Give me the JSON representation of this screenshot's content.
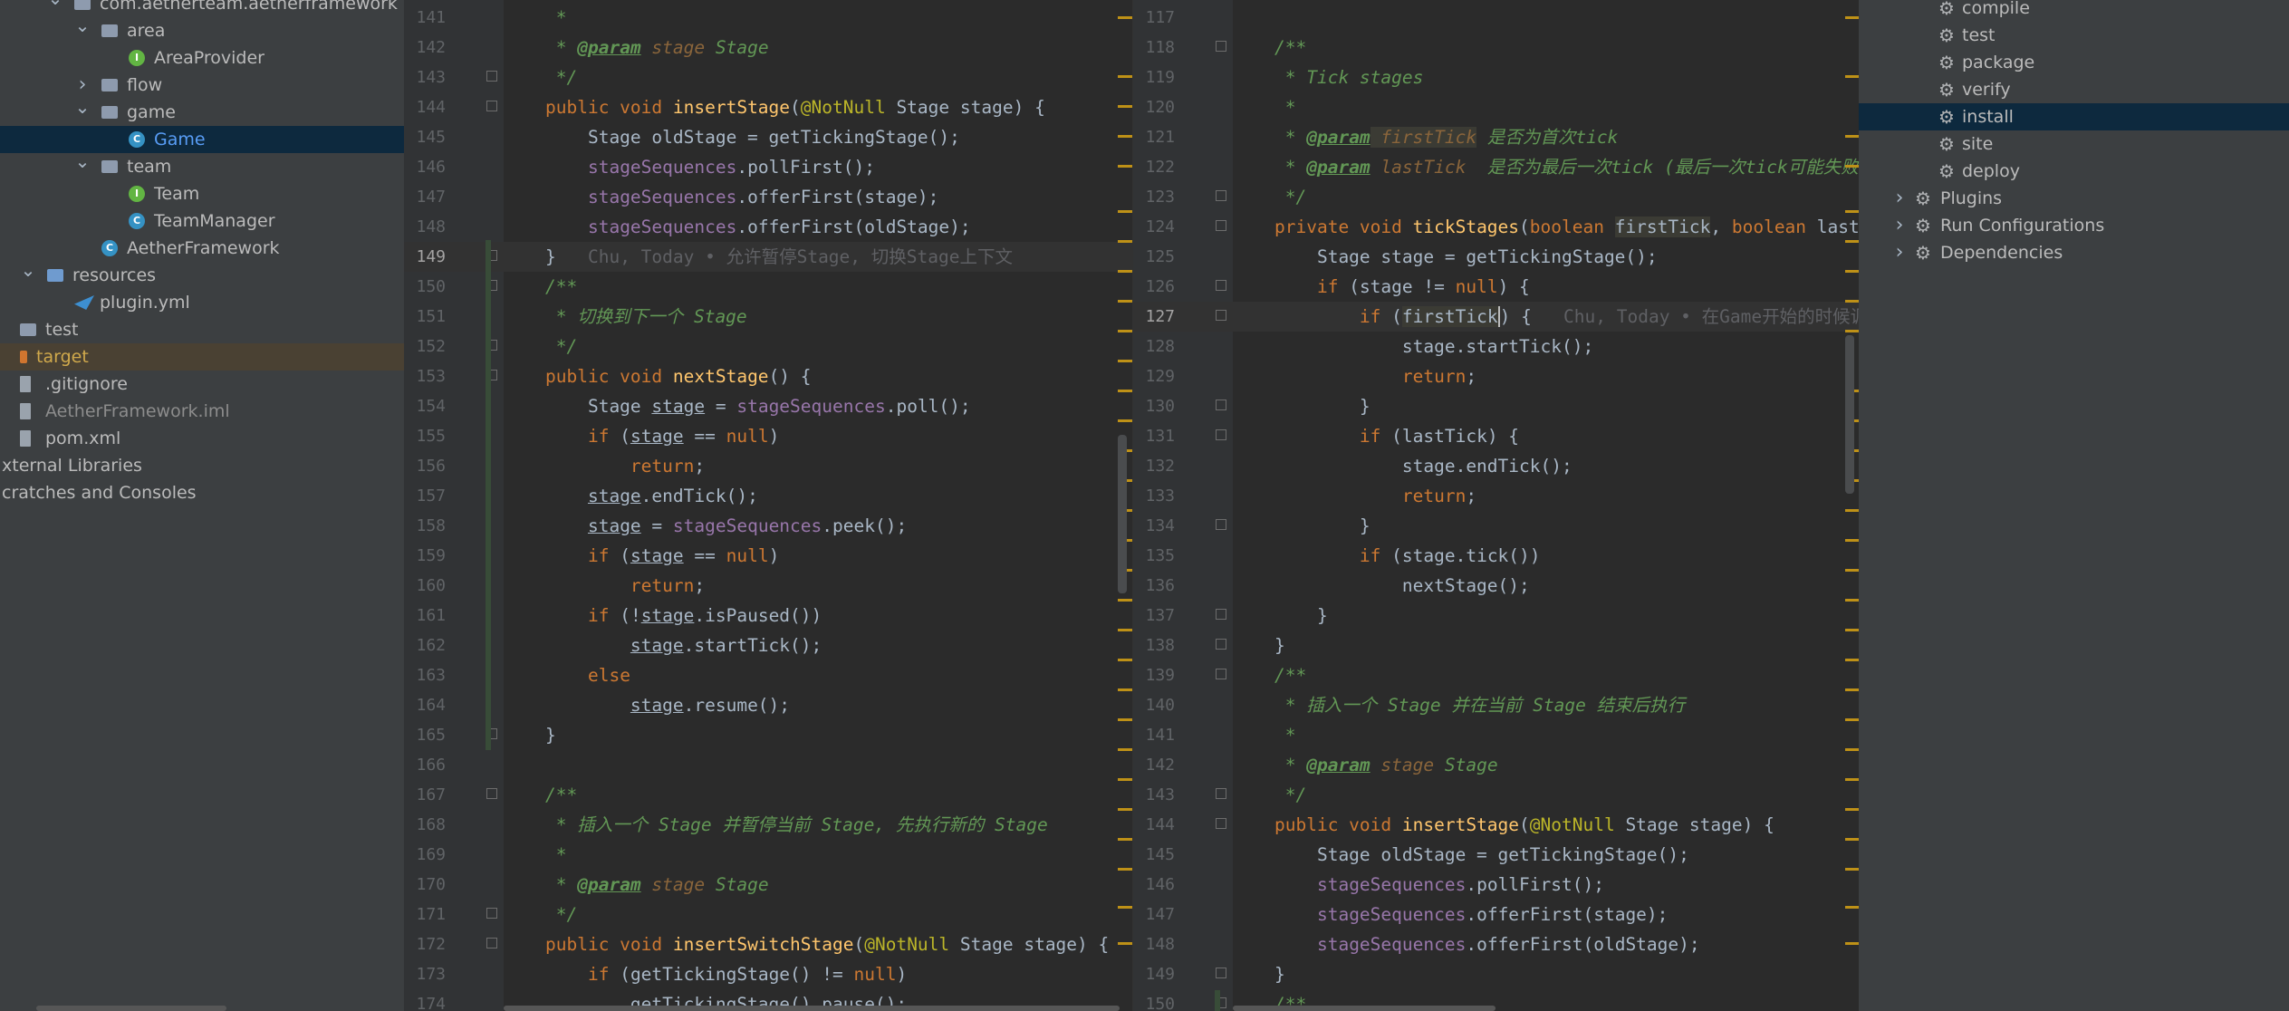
{
  "project": {
    "items": [
      {
        "label": "com.aetherteam.aetherframework",
        "indent": 1,
        "arrow": "v",
        "icon": "folder",
        "state": ""
      },
      {
        "label": "area",
        "indent": 2,
        "arrow": "v",
        "icon": "folder",
        "state": ""
      },
      {
        "label": "AreaProvider",
        "indent": 3,
        "arrow": "",
        "icon": "interface",
        "state": ""
      },
      {
        "label": "flow",
        "indent": 2,
        "arrow": ">",
        "icon": "folder",
        "state": ""
      },
      {
        "label": "game",
        "indent": 2,
        "arrow": "v",
        "icon": "folder",
        "state": ""
      },
      {
        "label": "Game",
        "indent": 3,
        "arrow": "",
        "icon": "class",
        "state": "selected"
      },
      {
        "label": "team",
        "indent": 2,
        "arrow": "v",
        "icon": "folder",
        "state": ""
      },
      {
        "label": "Team",
        "indent": 3,
        "arrow": "",
        "icon": "interface",
        "state": ""
      },
      {
        "label": "TeamManager",
        "indent": 3,
        "arrow": "",
        "icon": "class",
        "state": ""
      },
      {
        "label": "AetherFramework",
        "indent": 2,
        "arrow": "",
        "icon": "class",
        "state": ""
      },
      {
        "label": "resources",
        "indent": 0,
        "arrow": "v",
        "icon": "folder-res",
        "state": ""
      },
      {
        "label": "plugin.yml",
        "indent": 1,
        "arrow": "",
        "icon": "yml",
        "state": ""
      },
      {
        "label": "test",
        "indent": -1,
        "arrow": "",
        "icon": "folder",
        "state": ""
      },
      {
        "label": "target",
        "indent": -1,
        "arrow": "",
        "icon": "folder-excluded",
        "state": "highlight"
      },
      {
        "label": ".gitignore",
        "indent": -1,
        "arrow": "",
        "icon": "file",
        "state": ""
      },
      {
        "label": "AetherFramework.iml",
        "indent": -1,
        "arrow": "",
        "icon": "file",
        "state": "dim"
      },
      {
        "label": "pom.xml",
        "indent": -1,
        "arrow": "",
        "icon": "file",
        "state": ""
      },
      {
        "label": "xternal Libraries",
        "indent": -2,
        "arrow": "",
        "icon": "",
        "state": ""
      },
      {
        "label": "cratches and Consoles",
        "indent": -2,
        "arrow": "",
        "icon": "",
        "state": ""
      }
    ]
  },
  "editor_left": {
    "current_line": 149,
    "lines": [
      {
        "n": 141,
        "fold": false,
        "html": "<span class=\"cm\"> *</span>"
      },
      {
        "n": 142,
        "fold": false,
        "html": "<span class=\"cm\"> * </span><span class=\"tag\">@param</span><span class=\"pv\"> stage</span><span class=\"cm\"> Stage</span>"
      },
      {
        "n": 143,
        "fold": true,
        "html": "<span class=\"cm\"> */</span>"
      },
      {
        "n": 144,
        "fold": true,
        "html": "<span class=\"kw\">public void </span><span class=\"fn\">insertStage</span>(<span class=\"an\">@NotNull</span> Stage stage) {"
      },
      {
        "n": 145,
        "fold": false,
        "html": "    Stage oldStage = getTickingStage();"
      },
      {
        "n": 146,
        "fold": false,
        "html": "    <span class=\"fld\">stageSequences</span>.pollFirst();"
      },
      {
        "n": 147,
        "fold": false,
        "html": "    <span class=\"fld\">stageSequences</span>.offerFirst(stage);"
      },
      {
        "n": 148,
        "fold": false,
        "html": "    <span class=\"fld\">stageSequences</span>.offerFirst(oldStage);"
      },
      {
        "n": 149,
        "fold": true,
        "html": "}   <span class=\"ca\">Chu, Today • 允许暂停Stage, 切换Stage上下文</span>"
      },
      {
        "n": 150,
        "fold": true,
        "html": "<span class=\"cm\">/**</span>"
      },
      {
        "n": 151,
        "fold": false,
        "html": "<span class=\"cm\"> * 切换到下一个 Stage</span>"
      },
      {
        "n": 152,
        "fold": true,
        "html": "<span class=\"cm\"> */</span>"
      },
      {
        "n": 153,
        "fold": true,
        "html": "<span class=\"kw\">public void </span><span class=\"fn\">nextStage</span>() {"
      },
      {
        "n": 154,
        "fold": false,
        "html": "    Stage <span class=\"ul\">stage</span> = <span class=\"fld\">stageSequences</span>.poll();"
      },
      {
        "n": 155,
        "fold": false,
        "html": "    <span class=\"kw\">if </span>(<span class=\"ul\">stage</span> == <span class=\"kw\">null</span>)"
      },
      {
        "n": 156,
        "fold": false,
        "html": "        <span class=\"kw\">return</span>;"
      },
      {
        "n": 157,
        "fold": false,
        "html": "    <span class=\"ul\">stage</span>.endTick();"
      },
      {
        "n": 158,
        "fold": false,
        "html": "    <span class=\"ul\">stage</span> = <span class=\"fld\">stageSequences</span>.peek();"
      },
      {
        "n": 159,
        "fold": false,
        "html": "    <span class=\"kw\">if </span>(<span class=\"ul\">stage</span> == <span class=\"kw\">null</span>)"
      },
      {
        "n": 160,
        "fold": false,
        "html": "        <span class=\"kw\">return</span>;"
      },
      {
        "n": 161,
        "fold": false,
        "html": "    <span class=\"kw\">if </span>(!<span class=\"ul\">stage</span>.isPaused())"
      },
      {
        "n": 162,
        "fold": false,
        "html": "        <span class=\"ul\">stage</span>.startTick();"
      },
      {
        "n": 163,
        "fold": false,
        "html": "    <span class=\"kw\">else</span>"
      },
      {
        "n": 164,
        "fold": false,
        "html": "        <span class=\"ul\">stage</span>.resume();"
      },
      {
        "n": 165,
        "fold": true,
        "html": "}"
      },
      {
        "n": 166,
        "fold": false,
        "html": ""
      },
      {
        "n": 167,
        "fold": true,
        "html": "<span class=\"cm\">/**</span>"
      },
      {
        "n": 168,
        "fold": false,
        "html": "<span class=\"cm\"> * 插入一个 Stage 并暂停当前 Stage, 先执行新的 Stage</span>"
      },
      {
        "n": 169,
        "fold": false,
        "html": "<span class=\"cm\"> *</span>"
      },
      {
        "n": 170,
        "fold": false,
        "html": "<span class=\"cm\"> * </span><span class=\"tag\">@param</span><span class=\"pv\"> stage</span><span class=\"cm\"> Stage</span>"
      },
      {
        "n": 171,
        "fold": true,
        "html": "<span class=\"cm\"> */</span>"
      },
      {
        "n": 172,
        "fold": true,
        "html": "<span class=\"kw\">public void </span><span class=\"fn\">insertSwitchStage</span>(<span class=\"an\">@NotNull</span> Stage stage) {"
      },
      {
        "n": 173,
        "fold": false,
        "html": "    <span class=\"kw\">if </span>(getTickingStage() != <span class=\"kw\">null</span>)"
      },
      {
        "n": 174,
        "fold": false,
        "html": "        getTickingStage().pause();"
      }
    ]
  },
  "editor_right": {
    "current_line": 127,
    "lines": [
      {
        "n": 117,
        "fold": false,
        "html": ""
      },
      {
        "n": 118,
        "fold": true,
        "html": "<span class=\"cm\">/**</span>"
      },
      {
        "n": 119,
        "fold": false,
        "html": "<span class=\"cm\"> * Tick stages</span>"
      },
      {
        "n": 120,
        "fold": false,
        "html": "<span class=\"cm\"> *</span>"
      },
      {
        "n": 121,
        "fold": false,
        "html": "<span class=\"cm\"> * </span><span class=\"tag\">@param</span><span class=\"pv hlvar\"> firstTick</span><span class=\"cm\"> 是否为首次tick</span>"
      },
      {
        "n": 122,
        "fold": false,
        "html": "<span class=\"cm\"> * </span><span class=\"tag\">@param</span><span class=\"pv\"> lastTick</span><span class=\"cm\">  是否为最后一次tick (最后一次tick可能失败)</span>"
      },
      {
        "n": 123,
        "fold": true,
        "html": "<span class=\"cm\"> */</span>"
      },
      {
        "n": 124,
        "fold": true,
        "html": "<span class=\"kw\">private void </span><span class=\"fn\">tickStages</span>(<span class=\"kw\">boolean </span><span class=\"hlvar\">firstTick</span>, <span class=\"kw\">boolean </span>lastTick) {"
      },
      {
        "n": 125,
        "fold": false,
        "html": "    Stage stage = getTickingStage();"
      },
      {
        "n": 126,
        "fold": true,
        "html": "    <span class=\"kw\">if </span>(stage != <span class=\"kw\">null</span>) {"
      },
      {
        "n": 127,
        "fold": true,
        "html": "        <span class=\"kw\">if </span>(<span class=\"hlvar\">firstTick</span><span class=\"cursor\">)</span> {   <span class=\"ca\">Chu, Today • 在Game开始的时候调用</span>"
      },
      {
        "n": 128,
        "fold": false,
        "html": "            stage.startTick();"
      },
      {
        "n": 129,
        "fold": false,
        "html": "            <span class=\"kw\">return</span>;"
      },
      {
        "n": 130,
        "fold": true,
        "html": "        }"
      },
      {
        "n": 131,
        "fold": true,
        "html": "        <span class=\"kw\">if </span>(lastTick) {"
      },
      {
        "n": 132,
        "fold": false,
        "html": "            stage.endTick();"
      },
      {
        "n": 133,
        "fold": false,
        "html": "            <span class=\"kw\">return</span>;"
      },
      {
        "n": 134,
        "fold": true,
        "html": "        }"
      },
      {
        "n": 135,
        "fold": false,
        "html": "        <span class=\"kw\">if </span>(stage.tick())"
      },
      {
        "n": 136,
        "fold": false,
        "html": "            nextStage();"
      },
      {
        "n": 137,
        "fold": true,
        "html": "    }"
      },
      {
        "n": 138,
        "fold": true,
        "html": "}"
      },
      {
        "n": 139,
        "fold": true,
        "html": "<span class=\"cm\">/**</span>"
      },
      {
        "n": 140,
        "fold": false,
        "html": "<span class=\"cm\"> * 插入一个 Stage 并在当前 Stage 结束后执行</span>"
      },
      {
        "n": 141,
        "fold": false,
        "html": "<span class=\"cm\"> *</span>"
      },
      {
        "n": 142,
        "fold": false,
        "html": "<span class=\"cm\"> * </span><span class=\"tag\">@param</span><span class=\"pv\"> stage</span><span class=\"cm\"> Stage</span>"
      },
      {
        "n": 143,
        "fold": true,
        "html": "<span class=\"cm\"> */</span>"
      },
      {
        "n": 144,
        "fold": true,
        "html": "<span class=\"kw\">public void </span><span class=\"fn\">insertStage</span>(<span class=\"an\">@NotNull</span> Stage stage) {"
      },
      {
        "n": 145,
        "fold": false,
        "html": "    Stage oldStage = getTickingStage();"
      },
      {
        "n": 146,
        "fold": false,
        "html": "    <span class=\"fld\">stageSequences</span>.pollFirst();"
      },
      {
        "n": 147,
        "fold": false,
        "html": "    <span class=\"fld\">stageSequences</span>.offerFirst(stage);"
      },
      {
        "n": 148,
        "fold": false,
        "html": "    <span class=\"fld\">stageSequences</span>.offerFirst(oldStage);"
      },
      {
        "n": 149,
        "fold": true,
        "html": "}"
      },
      {
        "n": 150,
        "fold": true,
        "html": "<span class=\"cm\">/**</span>"
      }
    ]
  },
  "maven": {
    "items": [
      {
        "label": "compile",
        "kind": "goal",
        "state": ""
      },
      {
        "label": "test",
        "kind": "goal",
        "state": ""
      },
      {
        "label": "package",
        "kind": "goal",
        "state": ""
      },
      {
        "label": "verify",
        "kind": "goal",
        "state": ""
      },
      {
        "label": "install",
        "kind": "goal",
        "state": "selected"
      },
      {
        "label": "site",
        "kind": "goal",
        "state": ""
      },
      {
        "label": "deploy",
        "kind": "goal",
        "state": ""
      },
      {
        "label": "Plugins",
        "kind": "group",
        "state": ""
      },
      {
        "label": "Run Configurations",
        "kind": "group",
        "state": ""
      },
      {
        "label": "Dependencies",
        "kind": "group",
        "state": ""
      }
    ]
  }
}
